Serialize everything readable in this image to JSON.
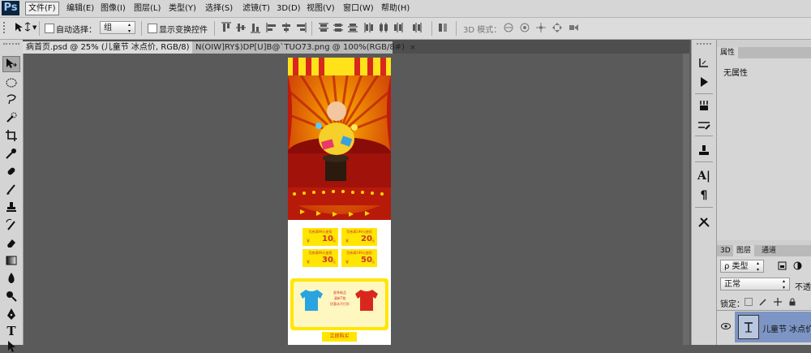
{
  "app": {
    "logo": "Ps"
  },
  "menu": [
    {
      "label": "文件(F)"
    },
    {
      "label": "编辑(E)"
    },
    {
      "label": "图像(I)"
    },
    {
      "label": "图层(L)"
    },
    {
      "label": "类型(Y)"
    },
    {
      "label": "选择(S)"
    },
    {
      "label": "滤镜(T)"
    },
    {
      "label": "3D(D)"
    },
    {
      "label": "视图(V)"
    },
    {
      "label": "窗口(W)"
    },
    {
      "label": "帮助(H)"
    }
  ],
  "options": {
    "auto_select_label": "自动选择：",
    "auto_select_value": "组",
    "show_transform_label": "显示变换控件",
    "mode3d_label": "3D 模式："
  },
  "tabs": [
    {
      "label": "病首页.psd @ 25% (儿童节 冰点价, RGB/8) *",
      "close": "×"
    },
    {
      "label": "N(OIW]RY$)DP[U]B@`TUO73.png @ 100%(RGB/8#)",
      "close": "×"
    }
  ],
  "properties_panel": {
    "tab": "属性",
    "empty_text": "无属性"
  },
  "layers_panel": {
    "tabs": [
      "3D",
      "图层",
      "通道"
    ],
    "filter_label": "ρ 类型",
    "blend_mode": "正常",
    "opacity_label": "不透",
    "lock_label": "锁定：",
    "layer_name": "儿童节 冰点价"
  },
  "canvas_content": {
    "coupons": [
      {
        "caption": "凭券满99元使用",
        "amount": "10"
      },
      {
        "caption": "凭券满199元使用",
        "amount": "20"
      },
      {
        "caption": "凭券满99元使用",
        "amount": "30"
      },
      {
        "caption": "凭券满199元使用",
        "amount": "50"
      }
    ],
    "coupon_currency": "￥",
    "coupon_unit": "元",
    "promo_lines": [
      "夏季新品",
      "清新T恤",
      "优惠永不打折"
    ],
    "buy_button": "立即购买"
  },
  "colors": {
    "menubar_bg": "#d6d6d6",
    "workspace_bg": "#5a5a5a",
    "banner_red": "#b01a0a",
    "banner_yellow": "#ffd600",
    "coupon_yellow": "#ffe600",
    "shirt_blue": "#2aa4e0",
    "shirt_red": "#d8281e"
  }
}
